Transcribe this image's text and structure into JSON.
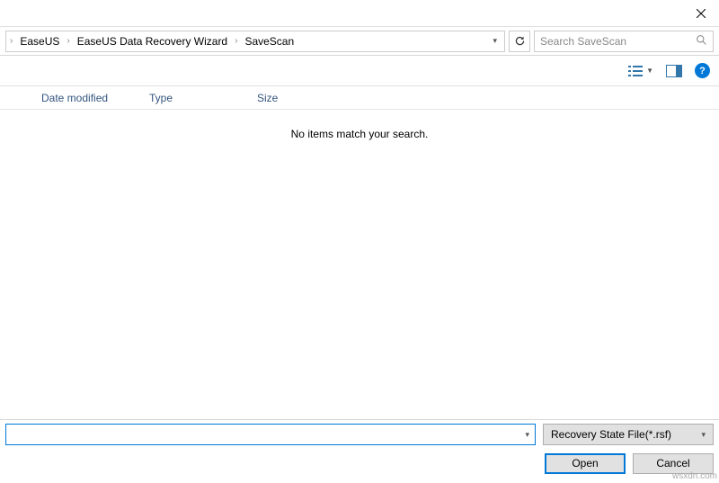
{
  "breadcrumbs": {
    "item0": "EaseUS",
    "item1": "EaseUS Data Recovery Wizard",
    "item2": "SaveScan"
  },
  "search": {
    "placeholder": "Search SaveScan"
  },
  "columns": {
    "date": "Date modified",
    "type": "Type",
    "size": "Size"
  },
  "empty": "No items match your search.",
  "filter": {
    "selected": "Recovery State File(*.rsf)"
  },
  "buttons": {
    "open": "Open",
    "cancel": "Cancel"
  },
  "watermark": "wsxdn.com"
}
